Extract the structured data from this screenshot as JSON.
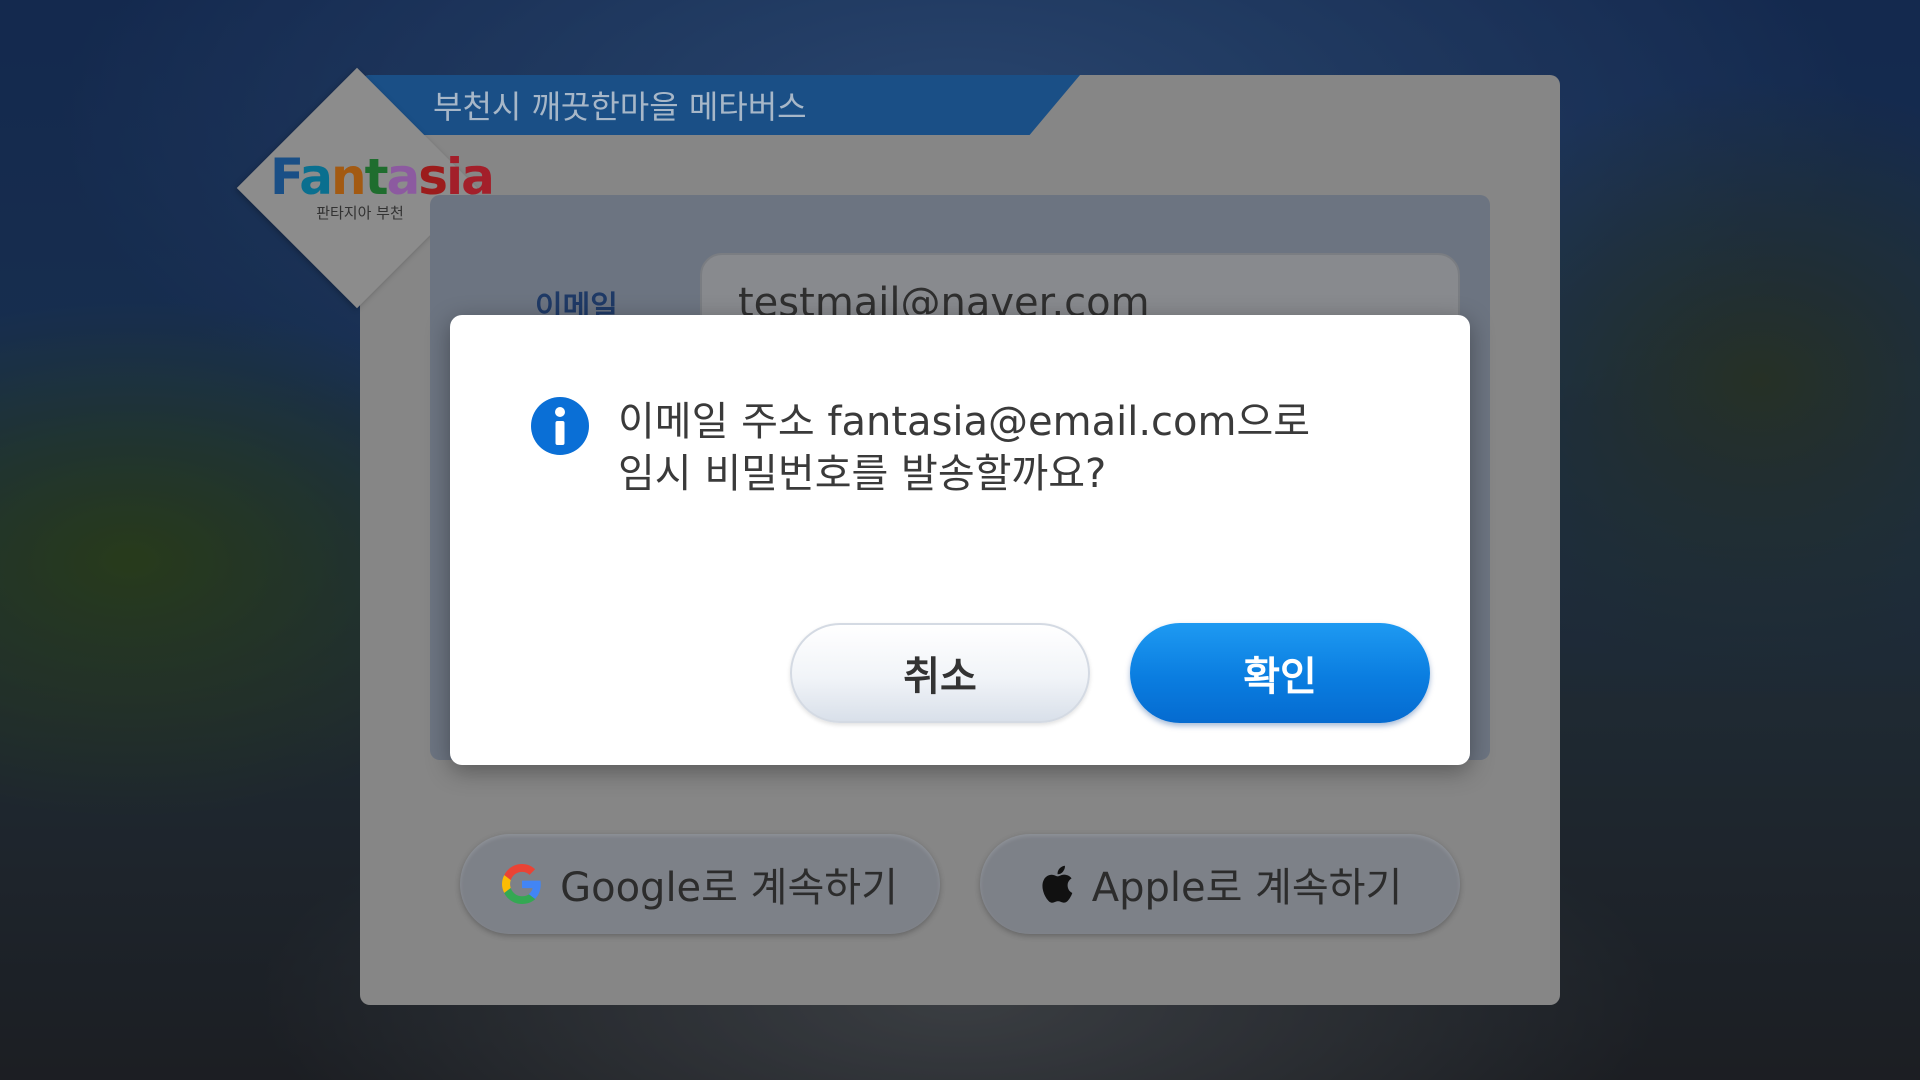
{
  "app": {
    "title": "부천시 깨끗한마을 메타버스",
    "logo": {
      "word": "Fantasia",
      "subtitle": "판타지아 부천"
    }
  },
  "form": {
    "email_label": "이메일",
    "email_value": "testmail@naver.com"
  },
  "social": {
    "google_label": "Google로 계속하기",
    "apple_label": "Apple로 계속하기"
  },
  "modal": {
    "icon": "info-icon",
    "message_line1": "이메일 주소 fantasia@email.com으로",
    "message_line2": "임시 비밀번호를 발송할까요?",
    "cancel_label": "취소",
    "confirm_label": "확인"
  },
  "colors": {
    "title_tab": "#1a4f86",
    "confirm_button": "#0a7de0",
    "info_icon": "#0a6fd6"
  }
}
